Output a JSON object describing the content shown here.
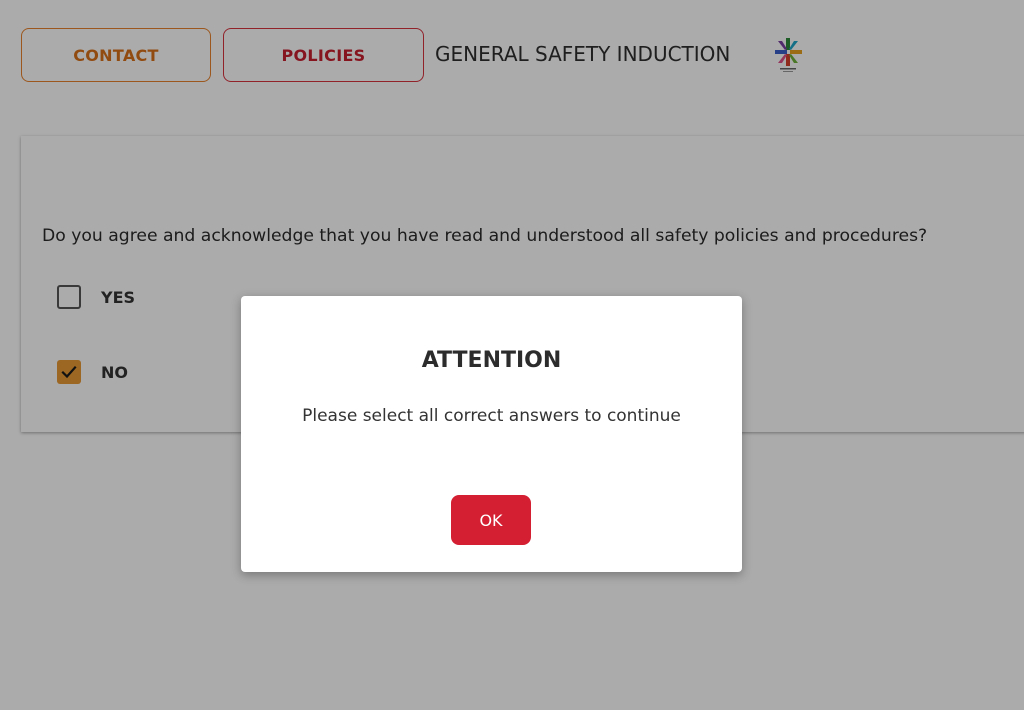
{
  "header": {
    "contact_label": "CONTACT",
    "policies_label": "POLICIES",
    "title": "GENERAL SAFETY INDUCTION",
    "logo_icon": "company-logo-icon"
  },
  "question": {
    "text": "Do you agree and acknowledge that you have read and understood all safety policies and procedures?",
    "options": [
      {
        "label": "YES",
        "checked": false
      },
      {
        "label": "NO",
        "checked": true
      }
    ]
  },
  "modal": {
    "title": "ATTENTION",
    "message": "Please select all correct answers to continue",
    "ok_label": "OK"
  },
  "colors": {
    "contact_accent": "#e8822c",
    "policies_accent": "#d9333f",
    "checkbox_checked": "#e99a34",
    "ok_button": "#d41f32"
  }
}
